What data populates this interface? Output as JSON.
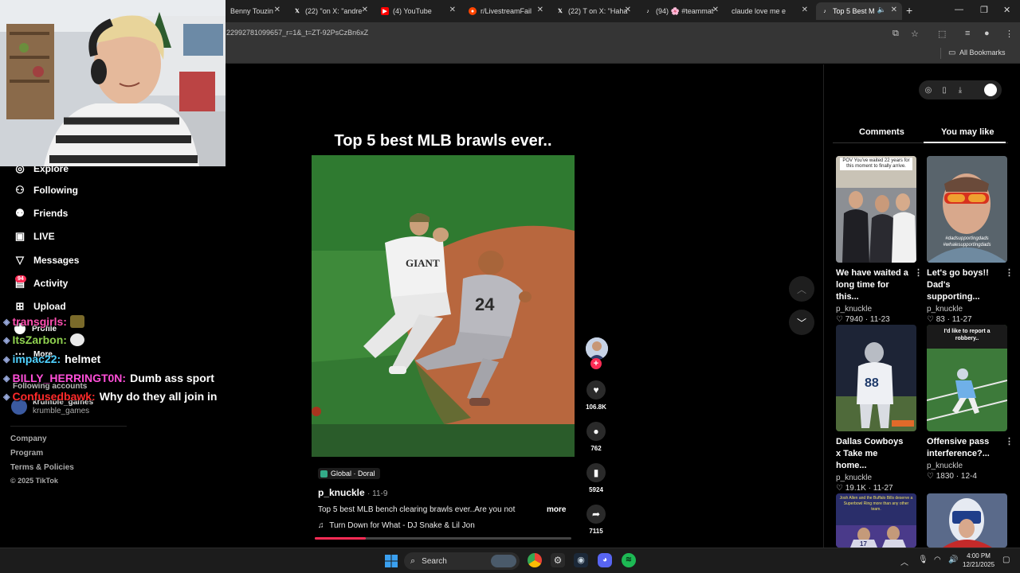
{
  "browser": {
    "tabs": [
      {
        "label": "Benny Touzin",
        "icon": "generic-tab-icon"
      },
      {
        "label": "(22) \"on X: \"andre",
        "icon": "x-icon"
      },
      {
        "label": "(4) YouTube",
        "icon": "youtube-icon"
      },
      {
        "label": "r/LivestreamFail",
        "icon": "reddit-icon"
      },
      {
        "label": "(22) T on X: \"Haha",
        "icon": "x-icon"
      },
      {
        "label": "(94) 🌸 #teammat",
        "icon": "tiktok-icon"
      },
      {
        "label": "claude love me e",
        "icon": "generic-tab-icon"
      },
      {
        "label": "Top 5 Best M",
        "icon": "tiktok-icon",
        "active": true
      }
    ],
    "url": "22992781099657_r=1&_t=ZT-92PsCzBn6xZ",
    "bookmarks_label": "All Bookmarks"
  },
  "nav": {
    "explore": "Explore",
    "following": "Following",
    "friends": "Friends",
    "live": "LIVE",
    "messages": "Messages",
    "activity": "Activity",
    "activity_badge": "94",
    "upload": "Upload",
    "profile": "Profile",
    "more": "More",
    "following_accounts": "Following accounts",
    "account_1": "krumble_games",
    "account_2": "krumble_games",
    "footer": [
      "Company",
      "Program",
      "Terms & Policies",
      "© 2025 TikTok"
    ]
  },
  "chat": [
    {
      "user": "transgirls:",
      "user_color": "#ff4fb0",
      "message": ""
    },
    {
      "user": "ItsZarbon:",
      "user_color": "#8fd14f",
      "message": ""
    },
    {
      "user": "impac22:",
      "user_color": "#4fd1ff",
      "message": "helmet"
    },
    {
      "user": "BILLY_HERRINGT0N:",
      "user_color": "#ff4fd8",
      "message": "Dumb ass sport"
    },
    {
      "user": "Confusedbawk:",
      "user_color": "#ff2a2a",
      "message": "Why do they all join in"
    }
  ],
  "video": {
    "title": "Top 5 best MLB brawls ever..",
    "location": "Global · Doral",
    "author": "p_knuckle",
    "date": "· 11-9",
    "caption": "Top 5 best MLB bench clearing brawls ever..Are you not",
    "more": "more",
    "music": "Turn Down for What - DJ Snake & Lil Jon",
    "progress": 0.2,
    "likes": "106.8K",
    "comments": "762",
    "saves": "5924",
    "shares": "7115",
    "jersey_number": "24",
    "jersey_text": "GIANT"
  },
  "right_panel": {
    "tab_comments": "Comments",
    "tab_you_may_like": "You may like",
    "cards": [
      {
        "title": "We have waited a long time for this...",
        "user": "p_knuckle",
        "likes": "7940",
        "date": "11-23",
        "overlay": "POV You've waited 22 years for this moment to finally arrive."
      },
      {
        "title": "Let's go boys!! Dad's supporting...",
        "user": "p_knuckle",
        "likes": "83",
        "date": "11-27",
        "overlay": "#dadsupportingdads #whalesupportingdads"
      },
      {
        "title": "Dallas Cowboys x Take me home...",
        "user": "p_knuckle",
        "likes": "19.1K",
        "date": "11-27",
        "overlay": ""
      },
      {
        "title": "Offensive pass interference?...",
        "user": "p_knuckle",
        "likes": "1830",
        "date": "12-4",
        "overlay": "I'd like to report a robbery.."
      },
      {
        "title": "",
        "user": "",
        "likes": "",
        "date": "",
        "overlay": "Josh Allen and the Buffalo Bills deserve a Superbowl Ring more than any other team."
      },
      {
        "title": "",
        "user": "",
        "likes": "",
        "date": "",
        "overlay": ""
      }
    ]
  },
  "taskbar": {
    "search": "Search",
    "time": "4:00 PM",
    "date": "12/21/2025"
  }
}
